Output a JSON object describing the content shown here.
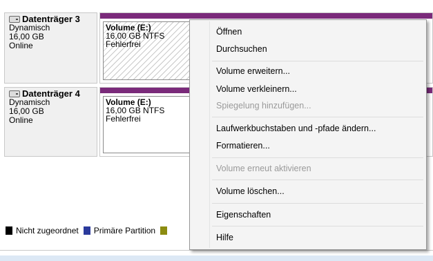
{
  "disks": [
    {
      "name": "Datenträger 3",
      "type": "Dynamisch",
      "size": "16,00 GB",
      "status": "Online",
      "volume": {
        "name": "Volume  (E:)",
        "details": "16,00 GB NTFS",
        "state": "Fehlerfrei"
      }
    },
    {
      "name": "Datenträger 4",
      "type": "Dynamisch",
      "size": "16,00 GB",
      "status": "Online",
      "volume": {
        "name": "Volume  (E:)",
        "details": "16,00 GB NTFS",
        "state": "Fehlerfrei"
      }
    }
  ],
  "legend": [
    {
      "label": "Nicht zugeordnet",
      "color": "#000000"
    },
    {
      "label": "Primäre Partition",
      "color": "#2b3a9c"
    },
    {
      "label": "",
      "color": "#8c8c10"
    }
  ],
  "colors": {
    "volume_bar": "#7a2a7a"
  },
  "context_menu": {
    "items": [
      {
        "label": "Öffnen",
        "enabled": true
      },
      {
        "label": "Durchsuchen",
        "enabled": true
      },
      {
        "label": "Volume erweitern...",
        "enabled": true
      },
      {
        "label": "Volume verkleinern...",
        "enabled": true
      },
      {
        "label": "Spiegelung hinzufügen...",
        "enabled": false
      },
      {
        "label": "Laufwerkbuchstaben und -pfade ändern...",
        "enabled": true
      },
      {
        "label": "Formatieren...",
        "enabled": true
      },
      {
        "label": "Volume erneut aktivieren",
        "enabled": false
      },
      {
        "label": "Volume löschen...",
        "enabled": true
      },
      {
        "label": "Eigenschaften",
        "enabled": true
      },
      {
        "label": "Hilfe",
        "enabled": true
      }
    ]
  }
}
